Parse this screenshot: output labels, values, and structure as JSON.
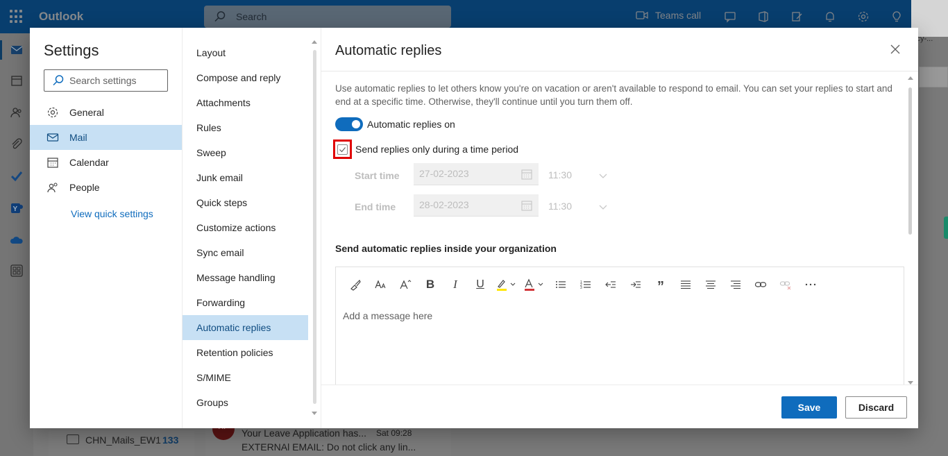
{
  "app": {
    "name": "Outlook",
    "search_placeholder": "Search",
    "teams_call": "Teams call"
  },
  "background": {
    "folder_name": "CHN_Mails_EW1",
    "folder_count": "133",
    "message_avatar": "HP",
    "message_subject": "Your Leave Application has...",
    "message_time": "Sat 09:28",
    "message_preview": "EXTERNAl EMAIL: Do not click any lin...",
    "right_snippet": "icy-..."
  },
  "settings": {
    "title": "Settings",
    "search_placeholder": "Search settings",
    "categories": [
      {
        "label": "General",
        "icon": "gear-icon"
      },
      {
        "label": "Mail",
        "icon": "mail-icon",
        "active": true
      },
      {
        "label": "Calendar",
        "icon": "calendar-icon"
      },
      {
        "label": "People",
        "icon": "people-icon"
      }
    ],
    "view_quick_settings": "View quick settings"
  },
  "mail_nav": {
    "items": [
      "Layout",
      "Compose and reply",
      "Attachments",
      "Rules",
      "Sweep",
      "Junk email",
      "Quick steps",
      "Customize actions",
      "Sync email",
      "Message handling",
      "Forwarding",
      "Automatic replies",
      "Retention policies",
      "S/MIME",
      "Groups"
    ],
    "active": "Automatic replies"
  },
  "auto_replies": {
    "title": "Automatic replies",
    "description": "Use automatic replies to let others know you're on vacation or aren't available to respond to email. You can set your replies to start and end at a specific time. Otherwise, they'll continue until you turn them off.",
    "toggle_label": "Automatic replies on",
    "toggle_on": true,
    "checkbox_label": "Send replies only during a time period",
    "checkbox_checked": true,
    "start_time_label": "Start time",
    "start_date": "27-02-2023",
    "start_time": "11:30",
    "end_time_label": "End time",
    "end_date": "28-02-2023",
    "end_time": "11:30",
    "inside_org_heading": "Send automatic replies inside your organization",
    "editor_placeholder": "Add a message here",
    "save_label": "Save",
    "discard_label": "Discard"
  },
  "colors": {
    "accent": "#0f6cbd",
    "selected_bg": "#c7e0f4",
    "highlight_box": "#e00000"
  }
}
